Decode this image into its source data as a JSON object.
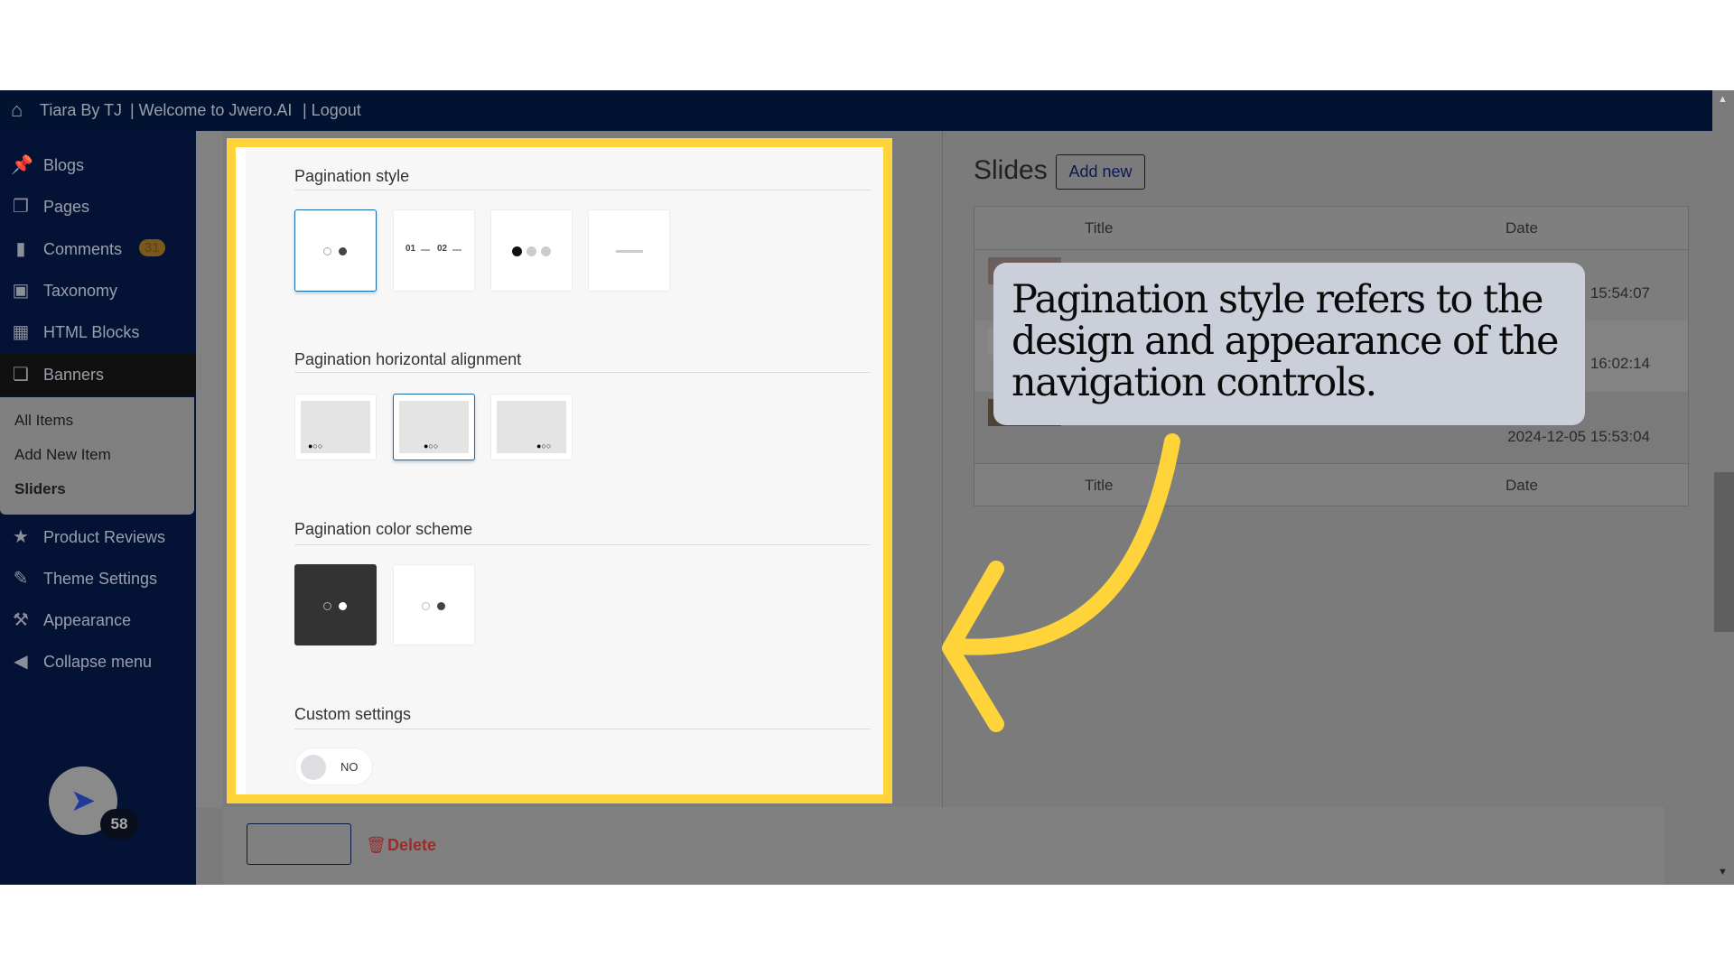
{
  "topbar": {
    "site": "Tiara By TJ",
    "welcome": "| Welcome to Jwero.AI",
    "logout": "| Logout"
  },
  "sidebar": {
    "items": [
      {
        "label": "Blogs",
        "icon": "pin-icon"
      },
      {
        "label": "Pages",
        "icon": "pages-icon"
      },
      {
        "label": "Comments",
        "icon": "comment-icon",
        "badge": "31"
      },
      {
        "label": "Taxonomy",
        "icon": "archive-icon"
      },
      {
        "label": "HTML Blocks",
        "icon": "code-icon"
      },
      {
        "label": "Banners",
        "icon": "banners-icon"
      },
      {
        "label": "Product Reviews",
        "icon": "star-icon"
      },
      {
        "label": "Theme Settings",
        "icon": "brush-icon"
      },
      {
        "label": "Appearance",
        "icon": "hammer-icon"
      },
      {
        "label": "Collapse menu",
        "icon": "collapse-icon"
      }
    ],
    "submenu": [
      "All Items",
      "Add New Item",
      "Sliders"
    ],
    "avatar_badge": "58"
  },
  "settings": {
    "pagination_style": "Pagination style",
    "alignment": "Pagination horizontal alignment",
    "color_scheme": "Pagination color scheme",
    "custom": "Custom settings",
    "style_num1": "01",
    "style_num2": "02",
    "toggle_label": "NO"
  },
  "bottom": {
    "delete": "Delete"
  },
  "slides": {
    "title": "Slides",
    "add_new": "Add new",
    "col_title": "Title",
    "col_date": "Date",
    "dates": [
      "15:54:07",
      "16:02:14",
      "2024-12-05 15:53:04"
    ]
  },
  "callout": {
    "text": "Pagination style refers to the design and appearance of the navigation controls."
  },
  "colors": {
    "highlight": "#ffd43b",
    "navy": "#021331",
    "selected": "#1b6aa5"
  }
}
